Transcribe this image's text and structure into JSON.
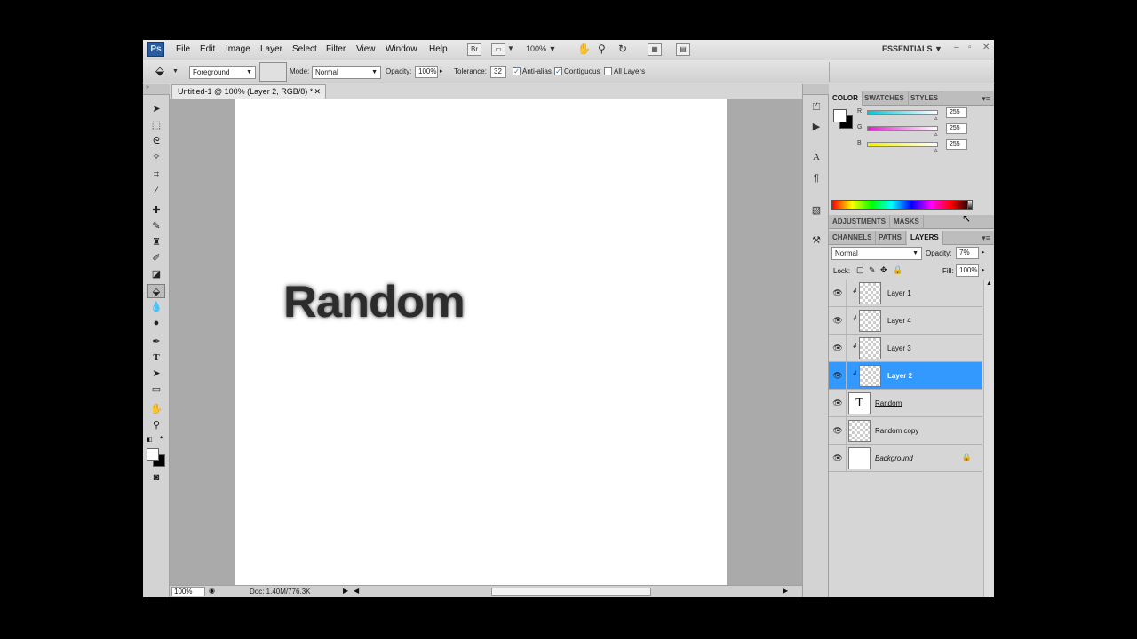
{
  "app": {
    "logo": "Ps",
    "menus": [
      "File",
      "Edit",
      "Image",
      "Layer",
      "Select",
      "Filter",
      "View",
      "Window",
      "Help"
    ],
    "zoom": "100%",
    "workspace": "ESSENTIALS",
    "icons": [
      "bridge-icon",
      "screen-mode-icon",
      "hand-icon",
      "zoom-icon",
      "rotate-icon",
      "arrange-icon",
      "extras-icon"
    ]
  },
  "options": {
    "fill_source": "Foreground",
    "mode_label": "Mode:",
    "mode_value": "Normal",
    "opacity_label": "Opacity:",
    "opacity_value": "100%",
    "tolerance_label": "Tolerance:",
    "tolerance_value": "32",
    "anti_alias_label": "Anti-alias",
    "contiguous_label": "Contiguous",
    "all_layers_label": "All Layers",
    "anti_alias_checked": true,
    "contiguous_checked": true,
    "all_layers_checked": false
  },
  "document": {
    "tab_title": "Untitled-1 @ 100% (Layer 2, RGB/8) *",
    "canvas_text": "Random",
    "status_zoom": "100%",
    "status_doc": "Doc: 1.40M/776.3K"
  },
  "color_panel": {
    "tabs": [
      "COLOR",
      "SWATCHES",
      "STYLES"
    ],
    "channels": [
      {
        "label": "R",
        "value": "255",
        "color": "#00c8d8"
      },
      {
        "label": "G",
        "value": "255",
        "color": "#e020d0"
      },
      {
        "label": "B",
        "value": "255",
        "color": "#f0f000"
      }
    ]
  },
  "adjustments_panel": {
    "tabs": [
      "ADJUSTMENTS",
      "MASKS"
    ]
  },
  "layers_panel": {
    "tabs": [
      "CHANNELS",
      "PATHS",
      "LAYERS"
    ],
    "blend_mode": "Normal",
    "opacity_label": "Opacity:",
    "opacity_value": "7%",
    "lock_label": "Lock:",
    "fill_label": "Fill:",
    "fill_value": "100%",
    "layers": [
      {
        "name": "Layer 1",
        "kind": "pixel",
        "clipped": true,
        "selected": false
      },
      {
        "name": "Layer 4",
        "kind": "pixel",
        "clipped": true,
        "selected": false
      },
      {
        "name": "Layer 3",
        "kind": "pixel",
        "clipped": true,
        "selected": false
      },
      {
        "name": "Layer 2",
        "kind": "pixel",
        "clipped": true,
        "selected": true
      },
      {
        "name": "Random",
        "kind": "type",
        "clipped": false,
        "selected": false
      },
      {
        "name": "Random copy",
        "kind": "pixel",
        "clipped": false,
        "selected": false
      },
      {
        "name": "Background",
        "kind": "background",
        "clipped": false,
        "selected": false
      }
    ]
  },
  "colors": {
    "selection": "#3399ff",
    "ps_logo": "#2a5b9c"
  }
}
